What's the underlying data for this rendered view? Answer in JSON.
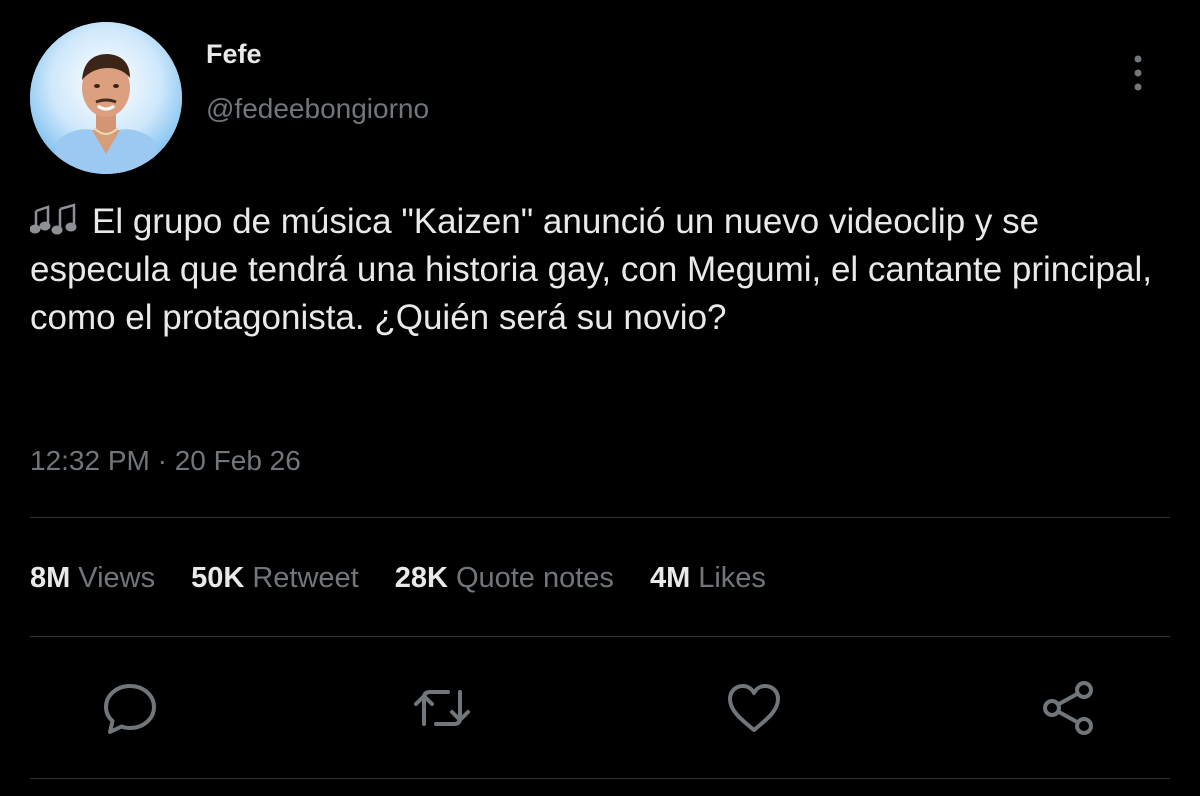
{
  "user": {
    "display_name": "Fefe",
    "handle": "@fedeebongiorno",
    "avatar": "profile-photo"
  },
  "tweet": {
    "emoji": "musical-notes",
    "text": "El grupo de música \"Kaizen\" anunció un nuevo videoclip y se especula que tendrá una historia gay, con Megumi, el cantante principal, como el protagonista. ¿Quién será su novio?",
    "timestamp": "12:32 PM · 20 Feb 26"
  },
  "stats": [
    {
      "value": "8M",
      "label": "Views"
    },
    {
      "value": "50K",
      "label": "Retweet"
    },
    {
      "value": "28K",
      "label": "Quote notes"
    },
    {
      "value": "4M",
      "label": "Likes"
    }
  ],
  "actions": {
    "reply": "reply-icon",
    "retweet": "retweet-icon",
    "like": "heart-icon",
    "share": "share-icon",
    "more": "more-options-icon"
  },
  "colors": {
    "background": "#000000",
    "primary_text": "#e7e9ea",
    "secondary_text": "#71767b",
    "divider": "#2f3336"
  }
}
